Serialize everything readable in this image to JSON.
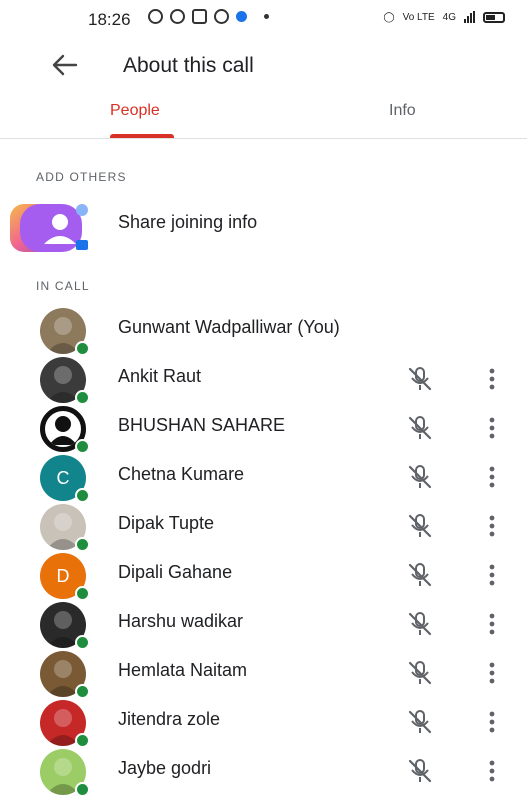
{
  "status_bar": {
    "time": "18:26",
    "network_label": "Vo LTE",
    "data_label": "4G"
  },
  "app_bar": {
    "title": "About this call",
    "back_icon": "arrow-back-icon"
  },
  "tabs": [
    {
      "label": "People",
      "selected": true
    },
    {
      "label": "Info",
      "selected": false
    }
  ],
  "add_others": {
    "header": "ADD OTHERS",
    "share_label": "Share joining info",
    "icon": "share-link-icon"
  },
  "in_call": {
    "header": "IN CALL",
    "participants": [
      {
        "name": "Gunwant Wadpalliwar (You)",
        "avatar": "photo",
        "initial": "",
        "color": "#8d7a5c",
        "muted_icon": false
      },
      {
        "name": "Ankit Raut",
        "avatar": "photo",
        "initial": "",
        "color": "#3b3b3b",
        "muted_icon": true
      },
      {
        "name": "BHUSHAN SAHARE",
        "avatar": "generic-person",
        "initial": "",
        "color": "#111111",
        "muted_icon": true
      },
      {
        "name": "Chetna Kumare",
        "avatar": "initial",
        "initial": "C",
        "color": "#12858c",
        "muted_icon": true
      },
      {
        "name": "Dipak Tupte",
        "avatar": "photo",
        "initial": "",
        "color": "#c9c2b8",
        "muted_icon": true
      },
      {
        "name": "Dipali Gahane",
        "avatar": "initial",
        "initial": "D",
        "color": "#e8710a",
        "muted_icon": true
      },
      {
        "name": "Harshu wadikar",
        "avatar": "photo",
        "initial": "",
        "color": "#2a2a2a",
        "muted_icon": true
      },
      {
        "name": "Hemlata Naitam",
        "avatar": "photo",
        "initial": "",
        "color": "#7a5a35",
        "muted_icon": true
      },
      {
        "name": "Jitendra zole",
        "avatar": "photo",
        "initial": "",
        "color": "#c62828",
        "muted_icon": true
      },
      {
        "name": "Jaybe godri",
        "avatar": "photo",
        "initial": "",
        "color": "#9ccc65",
        "muted_icon": true
      }
    ]
  },
  "colors": {
    "accent": "#d93025",
    "online": "#1e8e3e",
    "text": "#202124",
    "secondary": "#5f6368"
  }
}
